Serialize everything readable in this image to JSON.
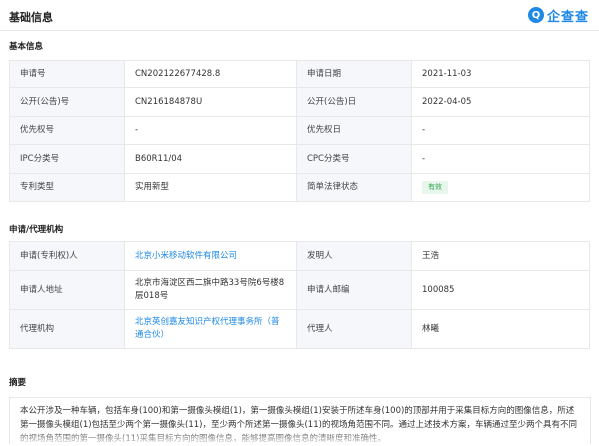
{
  "header": {
    "title": "基础信息",
    "brand_name": "企查查",
    "brand_mark": "Q"
  },
  "basic_info": {
    "section_title": "基本信息",
    "rows": [
      [
        {
          "label": "申请号",
          "value": "CN202122677428.8"
        },
        {
          "label": "申请日期",
          "value": "2021-11-03"
        }
      ],
      [
        {
          "label": "公开(公告)号",
          "value": "CN216184878U"
        },
        {
          "label": "公开(公告)日",
          "value": "2022-04-05"
        }
      ],
      [
        {
          "label": "优先权号",
          "value": "-"
        },
        {
          "label": "优先权日",
          "value": "-"
        }
      ],
      [
        {
          "label": "IPC分类号",
          "value": "B60R11/04"
        },
        {
          "label": "CPC分类号",
          "value": "-"
        }
      ],
      [
        {
          "label": "专利类型",
          "value": "实用新型"
        },
        {
          "label": "简单法律状态",
          "value": "有效"
        }
      ]
    ]
  },
  "agency": {
    "section_title": "申请/代理机构",
    "applicant_label": "申请(专利权)人",
    "applicant_value": "北京小米移动软件有限公司",
    "inventor_label": "发明人",
    "inventor_value": "王浩",
    "address_label": "申请人地址",
    "address_value": "北京市海淀区西二旗中路33号院6号楼8层018号",
    "postcode_label": "申请人邮编",
    "postcode_value": "100085",
    "agency_label": "代理机构",
    "agency_value": "北京英创嘉友知识产权代理事务所（普通合伙）",
    "agent_label": "代理人",
    "agent_value": "林曦"
  },
  "abstract": {
    "section_title": "摘要",
    "text": "本公开涉及一种车辆，包括车身(100)和第一摄像头模组(1)，第一摄像头模组(1)安装于所述车身(100)的顶部并用于采集目标方向的图像信息，所述第一摄像头模组(1)包括至少两个第一摄像头(11)，至少两个所述第一摄像头(11)的视场角范围不同。通过上述技术方案，车辆通过至少两个具有不同的视场角范围的第一摄像头(11)采集目标方向的图像信息，能够提高图像信息的清晰度和准确性。"
  }
}
